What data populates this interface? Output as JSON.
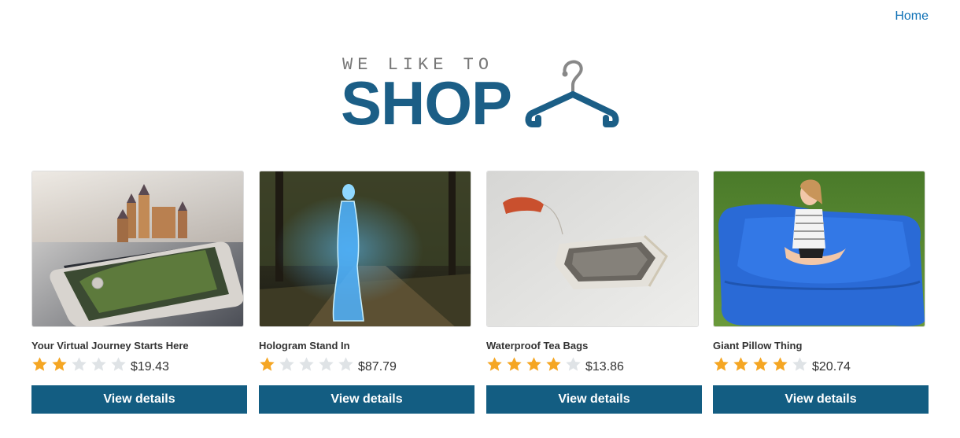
{
  "nav": {
    "home_label": "Home"
  },
  "logo": {
    "tagline": "WE LIKE TO",
    "word": "SHOP"
  },
  "colors": {
    "brand": "#1b5e86",
    "button": "#135d82",
    "link": "#0d70b5",
    "star_filled": "#f5a623",
    "star_empty": "#dfe3e6"
  },
  "products": [
    {
      "title": "Your Virtual Journey Starts Here",
      "rating": 2,
      "price": "$19.43",
      "button_label": "View details",
      "image": "phone-castle-image"
    },
    {
      "title": "Hologram Stand In",
      "rating": 1,
      "price": "$87.79",
      "button_label": "View details",
      "image": "hologram-woman-park-image"
    },
    {
      "title": "Waterproof Tea Bags",
      "rating": 4,
      "price": "$13.86",
      "button_label": "View details",
      "image": "tea-bag-image"
    },
    {
      "title": "Giant Pillow Thing",
      "rating": 4,
      "price": "$20.74",
      "button_label": "View details",
      "image": "girl-on-pillow-image"
    }
  ]
}
